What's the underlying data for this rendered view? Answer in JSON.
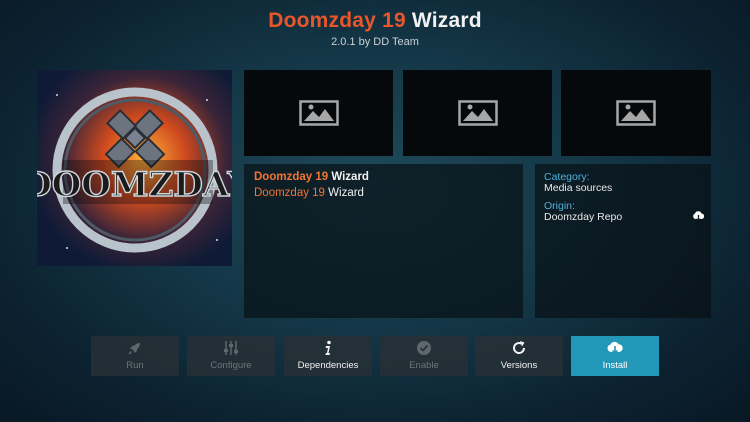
{
  "header": {
    "title_name": "Doomzday 19",
    "title_word": "Wizard",
    "subtitle": "2.0.1 by DD Team"
  },
  "poster": {
    "logo_text": "Doomzday"
  },
  "screenshots": [
    {
      "icon": "image-placeholder-icon"
    },
    {
      "icon": "image-placeholder-icon"
    },
    {
      "icon": "image-placeholder-icon"
    }
  ],
  "description": {
    "line1_name": "Doomzday 19",
    "line1_word": "Wizard",
    "line2_name": "Doomzday 19",
    "line2_word": "Wizard"
  },
  "info": {
    "category_label": "Category:",
    "category_value": "Media sources",
    "origin_label": "Origin:",
    "origin_value": "Doomzday Repo",
    "origin_icon": "cloud-download-icon"
  },
  "buttons": [
    {
      "label": "Run",
      "icon": "rocket-icon",
      "enabled": false
    },
    {
      "label": "Configure",
      "icon": "sliders-icon",
      "enabled": false
    },
    {
      "label": "Dependencies",
      "icon": "info-icon",
      "enabled": true
    },
    {
      "label": "Enable",
      "icon": "check-circle-icon",
      "enabled": false
    },
    {
      "label": "Versions",
      "icon": "refresh-icon",
      "enabled": true
    },
    {
      "label": "Install",
      "icon": "cloud-download-icon",
      "enabled": true,
      "focused": true
    }
  ],
  "colors": {
    "accent_orange": "#e8562a",
    "label_blue": "#4eb2d9",
    "focus_blue": "#2397b8"
  }
}
